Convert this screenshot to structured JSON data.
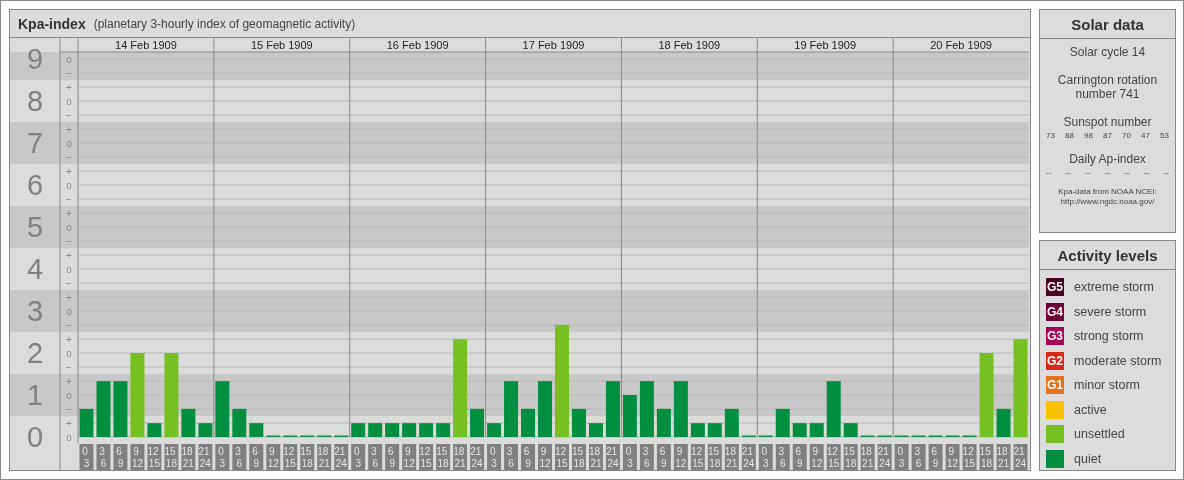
{
  "header": {
    "title": "Kpa-index",
    "subtitle": "(planetary 3-hourly index of geomagnetic activity)"
  },
  "kp_chart": {
    "band_marks": [
      "o",
      "−",
      "+",
      "o",
      "−",
      "+",
      "o",
      "−",
      "+",
      "o",
      "−",
      "+",
      "o",
      "−",
      "+",
      "o",
      "−",
      "+",
      "o",
      "−",
      "+",
      "o",
      "−",
      "+",
      "o",
      "−",
      "+",
      "o"
    ],
    "days": [
      "14 Feb 1909",
      "15 Feb 1909",
      "16 Feb 1909",
      "17 Feb 1909",
      "18 Feb 1909",
      "19 Feb 1909",
      "20 Feb 1909"
    ],
    "chart_data": {
      "type": "bar",
      "grid": true,
      "categories": [
        "0 3",
        "3 6",
        "6 9",
        "9 12",
        "12 15",
        "15 18",
        "18 21",
        "21 24",
        "0 3",
        "3 6",
        "6 9",
        "9 12",
        "12 15",
        "15 18",
        "18 21",
        "21 24",
        "0 3",
        "3 6",
        "6 9",
        "9 12",
        "12 15",
        "15 18",
        "18 21",
        "21 24",
        "0 3",
        "3 6",
        "6 9",
        "9 12",
        "12 15",
        "15 18",
        "18 21",
        "21 24",
        "0 3",
        "3 6",
        "6 9",
        "9 12",
        "12 15",
        "15 18",
        "18 21",
        "21 24",
        "0 3",
        "3 6",
        "6 9",
        "9 12",
        "12 15",
        "15 18",
        "18 21",
        "21 24",
        "0 3",
        "3 6",
        "6 9",
        "9 12",
        "12 15",
        "15 18",
        "18 21",
        "21 24"
      ],
      "series": [
        {
          "color": "#008f3f",
          "values": [
            0.67,
            1.33,
            1.33,
            null,
            0.33,
            null,
            0.67,
            0.33,
            1.33,
            0.67,
            0.33,
            0,
            0,
            0,
            0,
            0,
            0.33,
            0.33,
            0.33,
            0.33,
            0.33,
            0.33,
            null,
            0.67,
            0.33,
            1.33,
            0.67,
            1.33,
            null,
            0.67,
            0.33,
            1.33,
            1,
            1.33,
            0.67,
            1.33,
            0.33,
            0.33,
            0.67,
            0,
            0,
            0.67,
            0.33,
            0.33,
            1.33,
            0.33,
            0,
            0,
            0,
            0,
            0,
            0,
            0,
            null,
            0.67,
            null
          ]
        },
        {
          "color": "#77c022",
          "values": [
            null,
            null,
            null,
            2,
            null,
            2,
            null,
            null,
            null,
            null,
            null,
            null,
            null,
            null,
            null,
            null,
            null,
            null,
            null,
            null,
            null,
            null,
            2.33,
            null,
            null,
            null,
            null,
            null,
            2.67,
            null,
            null,
            null,
            null,
            null,
            null,
            null,
            null,
            null,
            null,
            null,
            null,
            null,
            null,
            null,
            null,
            null,
            null,
            null,
            null,
            null,
            null,
            null,
            null,
            2,
            null,
            2.33
          ]
        }
      ],
      "ylim": [
        0,
        9.17
      ],
      "yticks": [
        {
          "value": 0,
          "label": "0"
        },
        {
          "value": 1,
          "label": "1"
        },
        {
          "value": 2,
          "label": "2"
        },
        {
          "value": 3,
          "label": "3"
        },
        {
          "value": 4,
          "label": "4"
        },
        {
          "value": 5,
          "label": "5"
        },
        {
          "value": 6,
          "label": "6"
        },
        {
          "value": 7,
          "label": "7"
        },
        {
          "value": 8,
          "label": "8"
        },
        {
          "value": 9,
          "label": "9"
        }
      ]
    }
  },
  "solar_data": {
    "title": "Solar data",
    "solar_cycle": "Solar cycle 14",
    "carrington": "Carrington rotation number 741",
    "sunspot_title": "Sunspot number",
    "sunspot_numbers": [
      "73",
      "88",
      "98",
      "87",
      "70",
      "47",
      "53"
    ],
    "ap_title": "Daily Ap-index",
    "ap_values": [
      "--",
      "--",
      "--",
      "--",
      "--",
      "--",
      "--"
    ],
    "source": [
      "Kpa-data from NOAA NCEI:",
      "http://www.ngdc.noaa.gov/"
    ]
  },
  "activity_levels": {
    "title": "Activity levels",
    "items": [
      {
        "badge": "G5",
        "label": "extreme storm",
        "color": "#4a0023"
      },
      {
        "badge": "G4",
        "label": "severe storm",
        "color": "#6b0039"
      },
      {
        "badge": "G3",
        "label": "strong storm",
        "color": "#a8005a"
      },
      {
        "badge": "G2",
        "label": "moderate storm",
        "color": "#d42a16"
      },
      {
        "badge": "G1",
        "label": "minor storm",
        "color": "#e6731a"
      },
      {
        "label": "active",
        "color": "#f7c300"
      },
      {
        "label": "unsettled",
        "color": "#77c022"
      },
      {
        "label": "quiet",
        "color": "#008f3f"
      }
    ]
  }
}
